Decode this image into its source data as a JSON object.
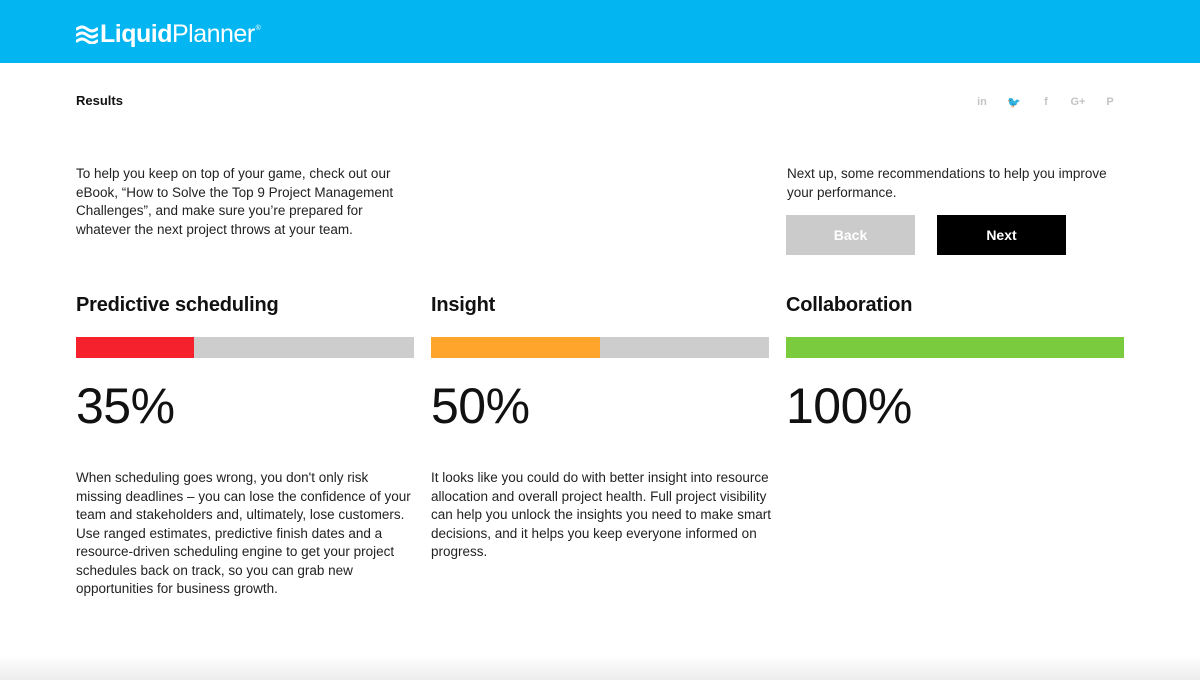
{
  "header": {
    "logo_bold": "Liquid",
    "logo_light": "Planner",
    "logo_reg": "®",
    "brand_color": "#03b5f0"
  },
  "page": {
    "results_label": "Results",
    "intro_text": "To help you keep on top of your game, check out our eBook, “How to Solve the Top 9 Project Management Challenges”, and make sure you’re prepared for whatever the next project throws at your team.",
    "next_intro_text": "Next up, some recommendations to help you improve your performance."
  },
  "social": [
    {
      "icon": "linkedin-icon",
      "glyph": "in"
    },
    {
      "icon": "twitter-icon",
      "glyph": "🐦"
    },
    {
      "icon": "facebook-icon",
      "glyph": "f"
    },
    {
      "icon": "google-plus-icon",
      "glyph": "G+"
    },
    {
      "icon": "pinterest-icon",
      "glyph": "P"
    }
  ],
  "buttons": {
    "back_label": "Back",
    "next_label": "Next"
  },
  "categories": [
    {
      "title": "Predictive scheduling",
      "percent_text": "35%",
      "progress": 0.35,
      "color": "#f5222d",
      "description": "When scheduling goes wrong, you don't only risk missing deadlines – you can lose the confidence of your team and stakeholders and, ultimately, lose customers. Use ranged estimates, predictive finish dates and a resource-driven scheduling engine to get your project schedules back on track, so you can grab new opportunities for business growth."
    },
    {
      "title": "Insight",
      "percent_text": "50%",
      "progress": 0.5,
      "color": "#ffa52c",
      "description": "It looks like you could do with better insight into resource allocation and overall project health. Full project visibility can help you unlock the insights you need to make smart decisions, and it helps you keep everyone informed on progress."
    },
    {
      "title": "Collaboration",
      "percent_text": "100%",
      "progress": 1.0,
      "color": "#7acc3e",
      "description": ""
    }
  ]
}
